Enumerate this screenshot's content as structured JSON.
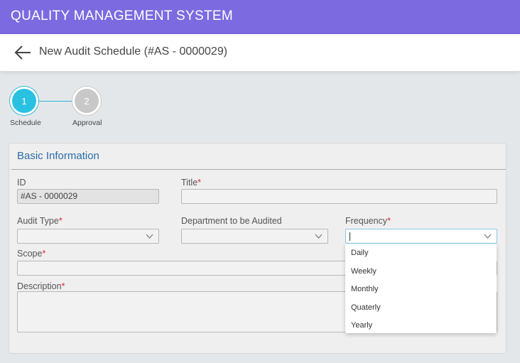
{
  "app": {
    "title": "QUALITY MANAGEMENT SYSTEM"
  },
  "header": {
    "page_title": "New Audit Schedule (#AS - 0000029)"
  },
  "stepper": {
    "steps": [
      {
        "number": "1",
        "label": "Schedule"
      },
      {
        "number": "2",
        "label": "Approval"
      }
    ]
  },
  "form": {
    "section_title": "Basic Information",
    "required_mark": "*",
    "id": {
      "label": "ID",
      "value": "#AS - 0000029"
    },
    "title": {
      "label": "Title",
      "value": ""
    },
    "audit_type": {
      "label": "Audit Type",
      "value": ""
    },
    "department": {
      "label": "Department to be Audited",
      "value": ""
    },
    "frequency": {
      "label": "Frequency",
      "value": ""
    },
    "scope": {
      "label": "Scope",
      "value": ""
    },
    "description": {
      "label": "Description",
      "value": ""
    }
  },
  "frequency_options": [
    "Daily",
    "Weekly",
    "Monthly",
    "Quaterly",
    "Yearly"
  ],
  "colors": {
    "appbar": "#7b6ae0",
    "accent": "#29c0e2",
    "section_title": "#2b6da8",
    "required": "#e0242e"
  },
  "icons": {
    "back": "arrow-left-icon",
    "dropdown": "chevron-down-icon"
  }
}
